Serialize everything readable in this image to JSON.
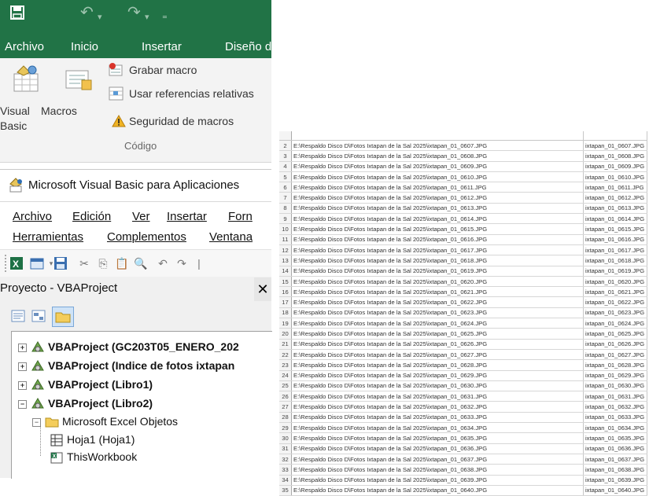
{
  "excel": {
    "quick_access": {
      "save": "save-icon",
      "undo": "undo-icon",
      "redo": "redo-icon",
      "customize": "customize-icon"
    },
    "tabs": [
      "Archivo",
      "Inicio",
      "Insertar",
      "Diseño d"
    ],
    "ribbon": {
      "visual_basic_line1": "Visual",
      "visual_basic_line2": "Basic",
      "macros": "Macros",
      "record_macro": "Grabar macro",
      "relative_refs": "Usar referencias relativas",
      "macro_security": "Seguridad de macros",
      "group_label": "Código"
    }
  },
  "vba": {
    "title": "Microsoft Visual Basic para Aplicaciones",
    "menu_row1": [
      "Archivo",
      "Edición",
      "Ver",
      "Insertar",
      "Forn"
    ],
    "menu_row2": [
      "Herramientas",
      "Complementos",
      "Ventana"
    ],
    "project_pane_title": "Proyecto - VBAProject",
    "tree": [
      {
        "label": "VBAProject (GC203T05_ENERO_202"
      },
      {
        "label": "VBAProject (Indice de fotos ixtapan"
      },
      {
        "label": "VBAProject (Libro1)"
      },
      {
        "label": "VBAProject (Libro2)"
      },
      {
        "label": "Microsoft Excel Objetos"
      },
      {
        "label": "Hoja1 (Hoja1)"
      },
      {
        "label": "ThisWorkbook"
      }
    ]
  },
  "sheet": {
    "rows": [
      {
        "n": "2",
        "path": "E:\\Respaldo Disco D\\Fotos Ixtapan de la Sal 2025\\ixtapan_01_0607.JPG",
        "file": "ixtapan_01_0607.JPG"
      },
      {
        "n": "3",
        "path": "E:\\Respaldo Disco D\\Fotos Ixtapan de la Sal 2025\\ixtapan_01_0608.JPG",
        "file": "ixtapan_01_0608.JPG"
      },
      {
        "n": "4",
        "path": "E:\\Respaldo Disco D\\Fotos Ixtapan de la Sal 2025\\ixtapan_01_0609.JPG",
        "file": "ixtapan_01_0609.JPG"
      },
      {
        "n": "5",
        "path": "E:\\Respaldo Disco D\\Fotos Ixtapan de la Sal 2025\\ixtapan_01_0610.JPG",
        "file": "ixtapan_01_0610.JPG"
      },
      {
        "n": "6",
        "path": "E:\\Respaldo Disco D\\Fotos Ixtapan de la Sal 2025\\ixtapan_01_0611.JPG",
        "file": "ixtapan_01_0611.JPG"
      },
      {
        "n": "7",
        "path": "E:\\Respaldo Disco D\\Fotos Ixtapan de la Sal 2025\\ixtapan_01_0612.JPG",
        "file": "ixtapan_01_0612.JPG"
      },
      {
        "n": "8",
        "path": "E:\\Respaldo Disco D\\Fotos Ixtapan de la Sal 2025\\ixtapan_01_0613.JPG",
        "file": "ixtapan_01_0613.JPG"
      },
      {
        "n": "9",
        "path": "E:\\Respaldo Disco D\\Fotos Ixtapan de la Sal 2025\\ixtapan_01_0614.JPG",
        "file": "ixtapan_01_0614.JPG"
      },
      {
        "n": "10",
        "path": "E:\\Respaldo Disco D\\Fotos Ixtapan de la Sal 2025\\ixtapan_01_0615.JPG",
        "file": "ixtapan_01_0615.JPG"
      },
      {
        "n": "11",
        "path": "E:\\Respaldo Disco D\\Fotos Ixtapan de la Sal 2025\\ixtapan_01_0616.JPG",
        "file": "ixtapan_01_0616.JPG"
      },
      {
        "n": "12",
        "path": "E:\\Respaldo Disco D\\Fotos Ixtapan de la Sal 2025\\ixtapan_01_0617.JPG",
        "file": "ixtapan_01_0617.JPG"
      },
      {
        "n": "13",
        "path": "E:\\Respaldo Disco D\\Fotos Ixtapan de la Sal 2025\\ixtapan_01_0618.JPG",
        "file": "ixtapan_01_0618.JPG"
      },
      {
        "n": "14",
        "path": "E:\\Respaldo Disco D\\Fotos Ixtapan de la Sal 2025\\ixtapan_01_0619.JPG",
        "file": "ixtapan_01_0619.JPG"
      },
      {
        "n": "15",
        "path": "E:\\Respaldo Disco D\\Fotos Ixtapan de la Sal 2025\\ixtapan_01_0620.JPG",
        "file": "ixtapan_01_0620.JPG"
      },
      {
        "n": "16",
        "path": "E:\\Respaldo Disco D\\Fotos Ixtapan de la Sal 2025\\ixtapan_01_0621.JPG",
        "file": "ixtapan_01_0621.JPG"
      },
      {
        "n": "17",
        "path": "E:\\Respaldo Disco D\\Fotos Ixtapan de la Sal 2025\\ixtapan_01_0622.JPG",
        "file": "ixtapan_01_0622.JPG"
      },
      {
        "n": "18",
        "path": "E:\\Respaldo Disco D\\Fotos Ixtapan de la Sal 2025\\ixtapan_01_0623.JPG",
        "file": "ixtapan_01_0623.JPG"
      },
      {
        "n": "19",
        "path": "E:\\Respaldo Disco D\\Fotos Ixtapan de la Sal 2025\\ixtapan_01_0624.JPG",
        "file": "ixtapan_01_0624.JPG"
      },
      {
        "n": "20",
        "path": "E:\\Respaldo Disco D\\Fotos Ixtapan de la Sal 2025\\ixtapan_01_0625.JPG",
        "file": "ixtapan_01_0625.JPG"
      },
      {
        "n": "21",
        "path": "E:\\Respaldo Disco D\\Fotos Ixtapan de la Sal 2025\\ixtapan_01_0626.JPG",
        "file": "ixtapan_01_0626.JPG"
      },
      {
        "n": "22",
        "path": "E:\\Respaldo Disco D\\Fotos Ixtapan de la Sal 2025\\ixtapan_01_0627.JPG",
        "file": "ixtapan_01_0627.JPG"
      },
      {
        "n": "23",
        "path": "E:\\Respaldo Disco D\\Fotos Ixtapan de la Sal 2025\\ixtapan_01_0628.JPG",
        "file": "ixtapan_01_0628.JPG"
      },
      {
        "n": "24",
        "path": "E:\\Respaldo Disco D\\Fotos Ixtapan de la Sal 2025\\ixtapan_01_0629.JPG",
        "file": "ixtapan_01_0629.JPG"
      },
      {
        "n": "25",
        "path": "E:\\Respaldo Disco D\\Fotos Ixtapan de la Sal 2025\\ixtapan_01_0630.JPG",
        "file": "ixtapan_01_0630.JPG"
      },
      {
        "n": "26",
        "path": "E:\\Respaldo Disco D\\Fotos Ixtapan de la Sal 2025\\ixtapan_01_0631.JPG",
        "file": "ixtapan_01_0631.JPG"
      },
      {
        "n": "27",
        "path": "E:\\Respaldo Disco D\\Fotos Ixtapan de la Sal 2025\\ixtapan_01_0632.JPG",
        "file": "ixtapan_01_0632.JPG"
      },
      {
        "n": "28",
        "path": "E:\\Respaldo Disco D\\Fotos Ixtapan de la Sal 2025\\ixtapan_01_0633.JPG",
        "file": "ixtapan_01_0633.JPG"
      },
      {
        "n": "29",
        "path": "E:\\Respaldo Disco D\\Fotos Ixtapan de la Sal 2025\\ixtapan_01_0634.JPG",
        "file": "ixtapan_01_0634.JPG"
      },
      {
        "n": "30",
        "path": "E:\\Respaldo Disco D\\Fotos Ixtapan de la Sal 2025\\ixtapan_01_0635.JPG",
        "file": "ixtapan_01_0635.JPG"
      },
      {
        "n": "31",
        "path": "E:\\Respaldo Disco D\\Fotos Ixtapan de la Sal 2025\\ixtapan_01_0636.JPG",
        "file": "ixtapan_01_0636.JPG"
      },
      {
        "n": "32",
        "path": "E:\\Respaldo Disco D\\Fotos Ixtapan de la Sal 2025\\ixtapan_01_0637.JPG",
        "file": "ixtapan_01_0637.JPG"
      },
      {
        "n": "33",
        "path": "E:\\Respaldo Disco D\\Fotos Ixtapan de la Sal 2025\\ixtapan_01_0638.JPG",
        "file": "ixtapan_01_0638.JPG"
      },
      {
        "n": "34",
        "path": "E:\\Respaldo Disco D\\Fotos Ixtapan de la Sal 2025\\ixtapan_01_0639.JPG",
        "file": "ixtapan_01_0639.JPG"
      },
      {
        "n": "35",
        "path": "E:\\Respaldo Disco D\\Fotos Ixtapan de la Sal 2025\\ixtapan_01_0640.JPG",
        "file": "ixtapan_01_0640.JPG"
      }
    ]
  }
}
